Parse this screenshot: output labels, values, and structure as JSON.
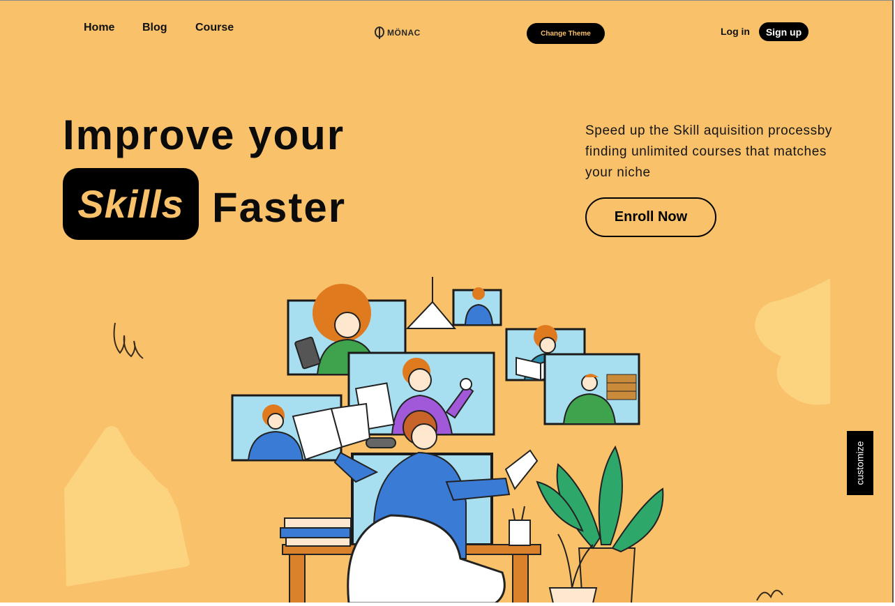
{
  "nav": {
    "links": [
      "Home",
      "Blog",
      "Course"
    ],
    "logo_text": "MÖNAC",
    "change_theme_label": "Change Theme",
    "login_label": "Log in",
    "signup_label": "Sign up"
  },
  "hero": {
    "line1": "Improve your",
    "highlight": "Skills",
    "line2_rest": "Faster",
    "description": "Speed up the Skill aquisition processby finding unlimited courses that matches your niche",
    "enroll_label": "Enroll Now"
  },
  "sidebar": {
    "customize_label": "customize"
  },
  "colors": {
    "background": "#f9c16a",
    "accent_dark": "#000000",
    "shape_light": "#fcd37e"
  },
  "illustration": {
    "icon": "online-learning-illustration"
  }
}
